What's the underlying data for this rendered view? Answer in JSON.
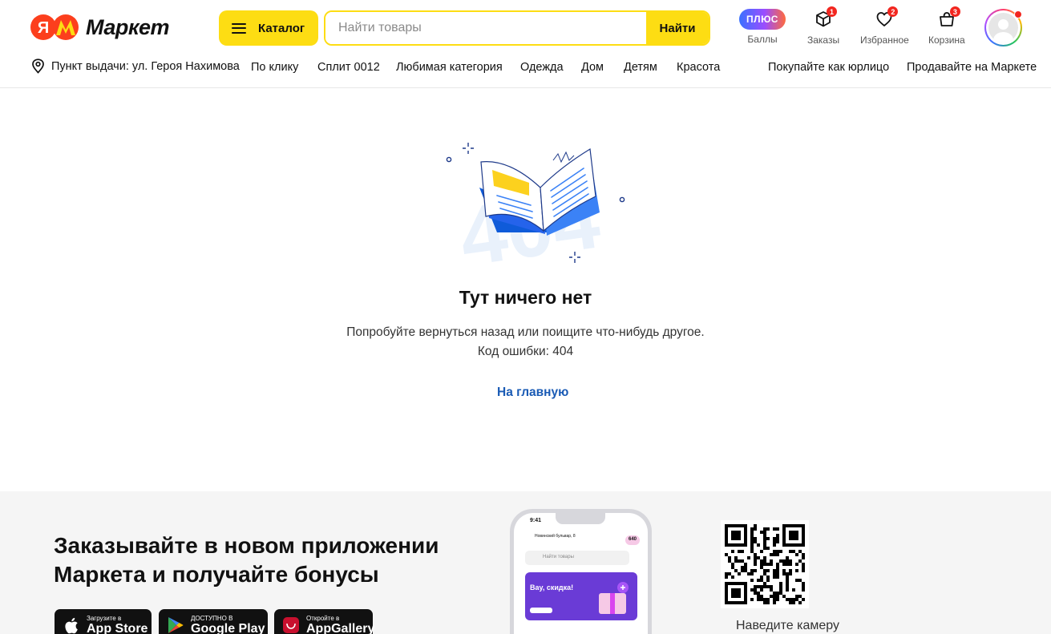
{
  "header": {
    "logo_text": "Маркет",
    "catalog_label": "Каталог",
    "search_placeholder": "Найти товары",
    "search_button": "Найти",
    "plus_label": "ПЛЮС",
    "points_label": "Баллы",
    "orders_label": "Заказы",
    "orders_count": "1",
    "favorites_label": "Избранное",
    "favorites_count": "2",
    "cart_label": "Корзина",
    "cart_count": "3"
  },
  "nav": {
    "pickup": "Пункт выдачи: ул. Героя Нахимова",
    "links": [
      "По клику",
      "Сплит 0012",
      "Любимая категория",
      "Одежда",
      "Дом",
      "Детям",
      "Красота"
    ],
    "business": "Покупайте как юрлицо",
    "sell": "Продавайте на Маркете"
  },
  "error": {
    "code_art": "404",
    "title": "Тут ничего нет",
    "description": "Попробуйте вернуться назад или поищите что-нибудь другое.",
    "code_text": "Код ошибки: 404",
    "home_link": "На главную"
  },
  "promo": {
    "title": "Заказывайте в новом приложении Маркета и получайте бонусы",
    "stores": [
      {
        "small": "Загрузите в",
        "big": "App Store",
        "icon": "apple-icon"
      },
      {
        "small": "ДОСТУПНО В",
        "big": "Google Play",
        "icon": "google-play-icon"
      },
      {
        "small": "Откройте в",
        "big": "AppGallery",
        "icon": "huawei-icon"
      }
    ],
    "phone": {
      "time": "9:41",
      "address": "Новинский бульвар, 8",
      "points": "640",
      "search": "Найти товары",
      "banner_title": "Вау, скидка!"
    },
    "qr_caption": "Наведите камеру"
  },
  "colors": {
    "brand_yellow": "#fddd13",
    "link_blue": "#1a5bb5",
    "badge_red": "#f2261f"
  }
}
